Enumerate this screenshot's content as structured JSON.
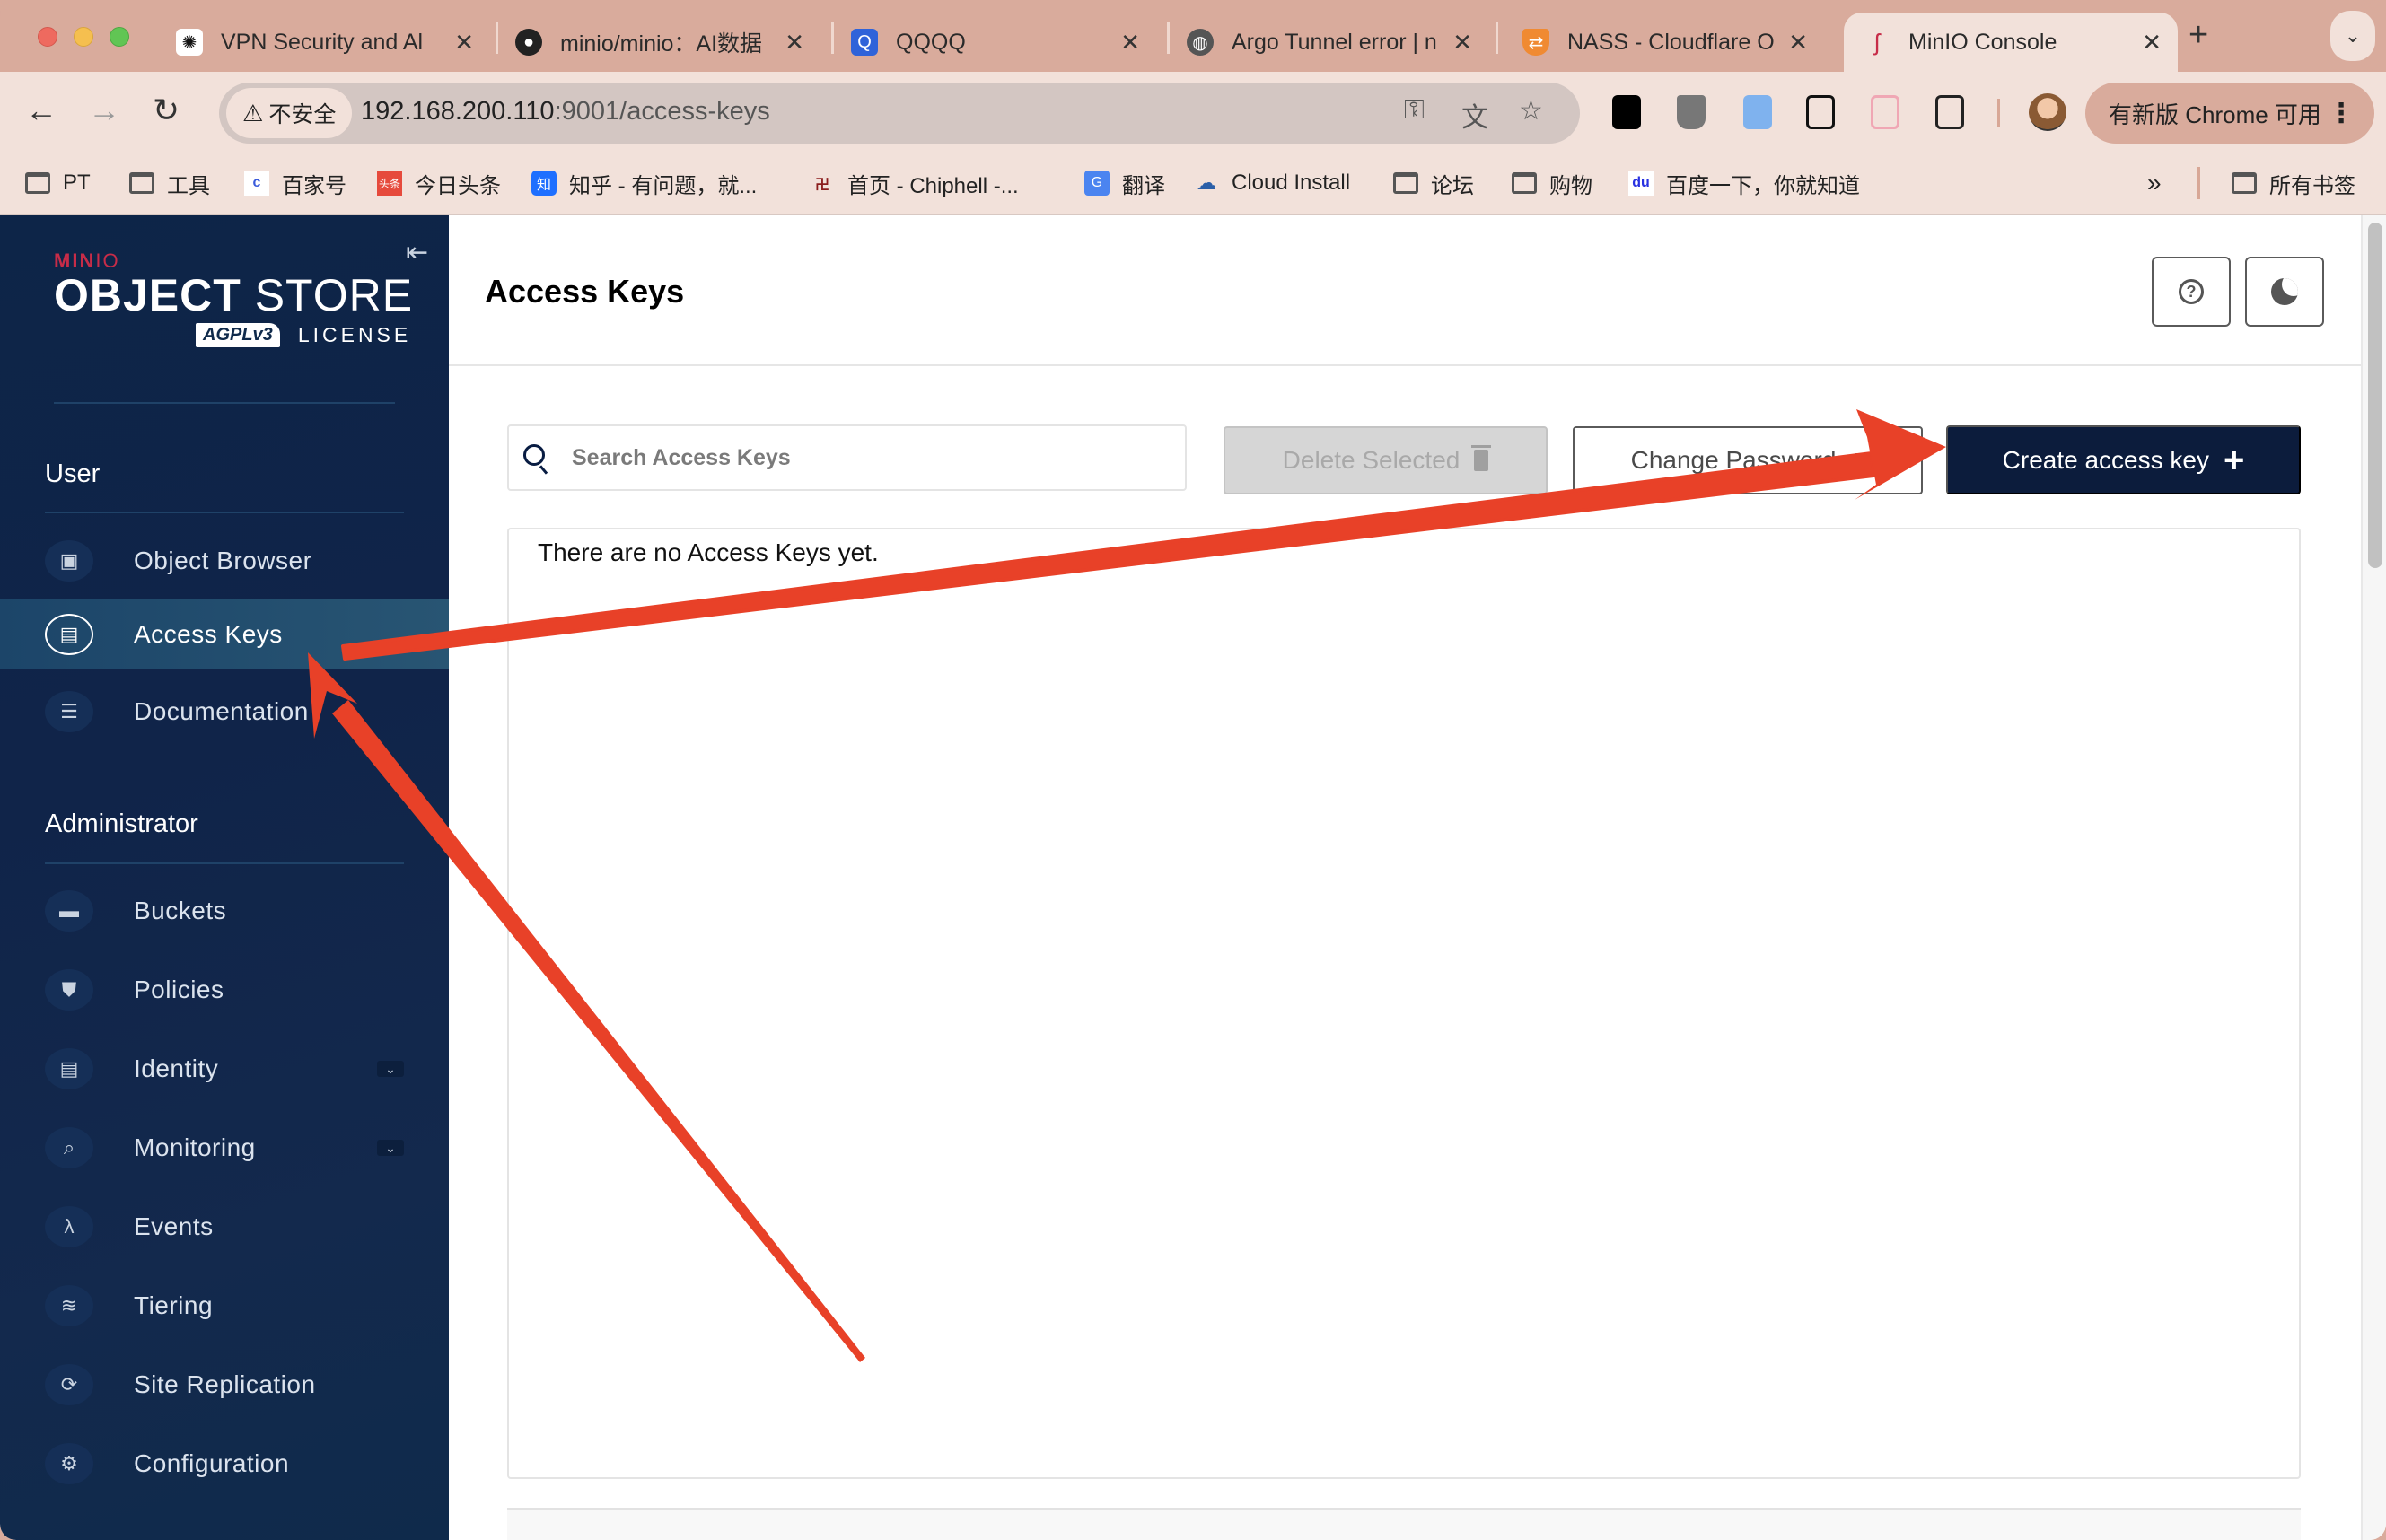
{
  "browser": {
    "tabs": [
      {
        "title": "VPN Security and Al",
        "favicon": "openai-icon",
        "active": false
      },
      {
        "title": "minio/minio：AI数据",
        "favicon": "github-icon",
        "active": false
      },
      {
        "title": "QQQQ",
        "favicon": "qqqq-icon",
        "active": false
      },
      {
        "title": "Argo Tunnel error | n",
        "favicon": "globe-icon",
        "active": false
      },
      {
        "title": "NASS - Cloudflare O",
        "favicon": "cloudflare-shield-icon",
        "active": false
      },
      {
        "title": "MinIO Console",
        "favicon": "minio-icon",
        "active": true
      }
    ],
    "tab_close_glyph": "✕",
    "new_tab_glyph": "+",
    "tab_menu_glyph": "⌄",
    "security_label": "不安全",
    "url_host": "192.168.200.110",
    "url_rest": ":9001/access-keys",
    "update_label": "有新版 Chrome 可用",
    "bookmarks": [
      {
        "label": "PT",
        "icon": "folder-icon"
      },
      {
        "label": "工具",
        "icon": "folder-icon"
      },
      {
        "label": "百家号",
        "icon": "baijiahao-icon"
      },
      {
        "label": "今日头条",
        "icon": "toutiao-icon"
      },
      {
        "label": "知乎 - 有问题，就...",
        "icon": "zhihu-icon"
      },
      {
        "label": "首页 - Chiphell -...",
        "icon": "chiphell-icon"
      },
      {
        "label": "翻译",
        "icon": "google-translate-icon"
      },
      {
        "label": "Cloud Install",
        "icon": "cloud-install-icon"
      },
      {
        "label": "论坛",
        "icon": "folder-icon"
      },
      {
        "label": "购物",
        "icon": "folder-icon"
      },
      {
        "label": "百度一下，你就知道",
        "icon": "baidu-icon"
      }
    ],
    "bookmarks_overflow": "»",
    "all_bookmarks": "所有书签"
  },
  "sidebar": {
    "logo": {
      "brand": "MIN",
      "brand_io": "IO",
      "product_bold": "OBJECT",
      "product_light": " STORE",
      "badge": "AGPLv3",
      "license": "LICENSE"
    },
    "collapse_glyph": "⇤",
    "sections": [
      {
        "title": "User",
        "items": [
          {
            "label": "Object Browser",
            "icon": "object-browser-icon",
            "glyph": "▣",
            "active": false
          },
          {
            "label": "Access Keys",
            "icon": "access-keys-icon",
            "glyph": "▤",
            "active": true
          },
          {
            "label": "Documentation",
            "icon": "documentation-icon",
            "glyph": "☰",
            "active": false
          }
        ]
      },
      {
        "title": "Administrator",
        "items": [
          {
            "label": "Buckets",
            "icon": "buckets-icon",
            "glyph": "▬",
            "active": false
          },
          {
            "label": "Policies",
            "icon": "policies-icon",
            "glyph": "⛊",
            "active": false
          },
          {
            "label": "Identity",
            "icon": "identity-icon",
            "glyph": "▤",
            "active": false,
            "expandable": true
          },
          {
            "label": "Monitoring",
            "icon": "monitoring-icon",
            "glyph": "⌕",
            "active": false,
            "expandable": true
          },
          {
            "label": "Events",
            "icon": "events-icon",
            "glyph": "λ",
            "active": false
          },
          {
            "label": "Tiering",
            "icon": "tiering-icon",
            "glyph": "≋",
            "active": false
          },
          {
            "label": "Site Replication",
            "icon": "site-replication-icon",
            "glyph": "⟳",
            "active": false
          },
          {
            "label": "Configuration",
            "icon": "configuration-icon",
            "glyph": "⚙",
            "active": false
          }
        ]
      }
    ]
  },
  "main": {
    "title": "Access Keys",
    "help_glyph": "?",
    "search_placeholder": "Search Access Keys",
    "search_value": "",
    "delete_label": "Delete Selected",
    "change_password_label": "Change Password",
    "create_label": "Create access key",
    "create_glyph": "+",
    "empty_message": "There are no Access Keys yet."
  },
  "annotation": {
    "color": "#e84128",
    "arrows": [
      {
        "from": "empty-area-below",
        "to": "sidebar-item-access-keys"
      },
      {
        "from": "sidebar-item-access-keys",
        "to": "create-access-key-button"
      }
    ]
  }
}
